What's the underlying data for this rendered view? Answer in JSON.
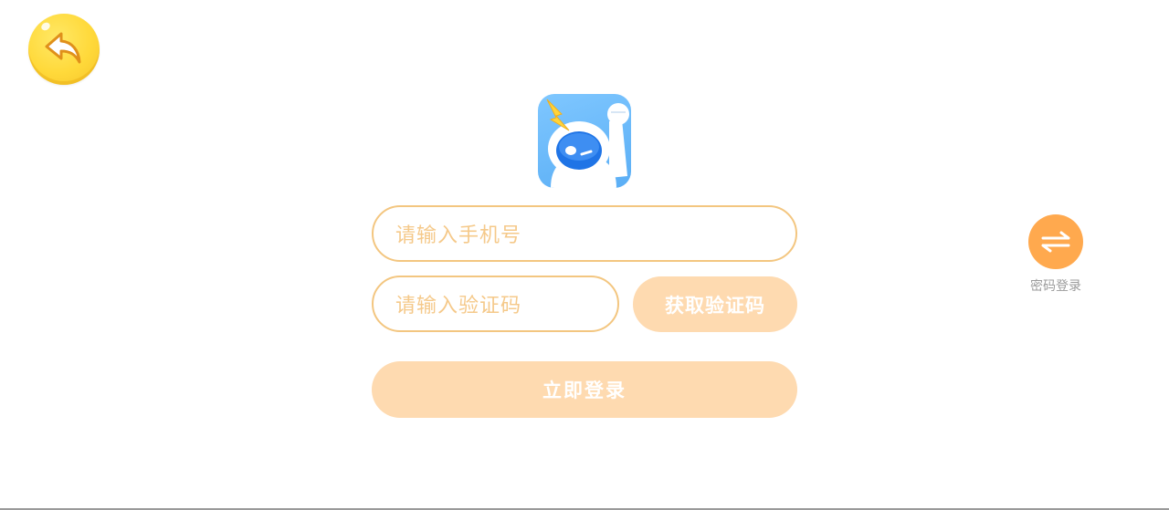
{
  "header": {
    "back_icon": "back-arrow-icon"
  },
  "logo": {
    "icon": "robot-mascot-icon"
  },
  "form": {
    "phone_placeholder": "请输入手机号",
    "code_placeholder": "请输入验证码",
    "get_code_label": "获取验证码",
    "login_label": "立即登录"
  },
  "switch_login": {
    "icon": "swap-arrows-icon",
    "label": "密码登录"
  },
  "colors": {
    "accent": "#ffa94e",
    "field_border": "#f3c680",
    "placeholder": "#f5c98a",
    "button_disabled": "#fedab0",
    "back_button": "#ffd93a"
  }
}
